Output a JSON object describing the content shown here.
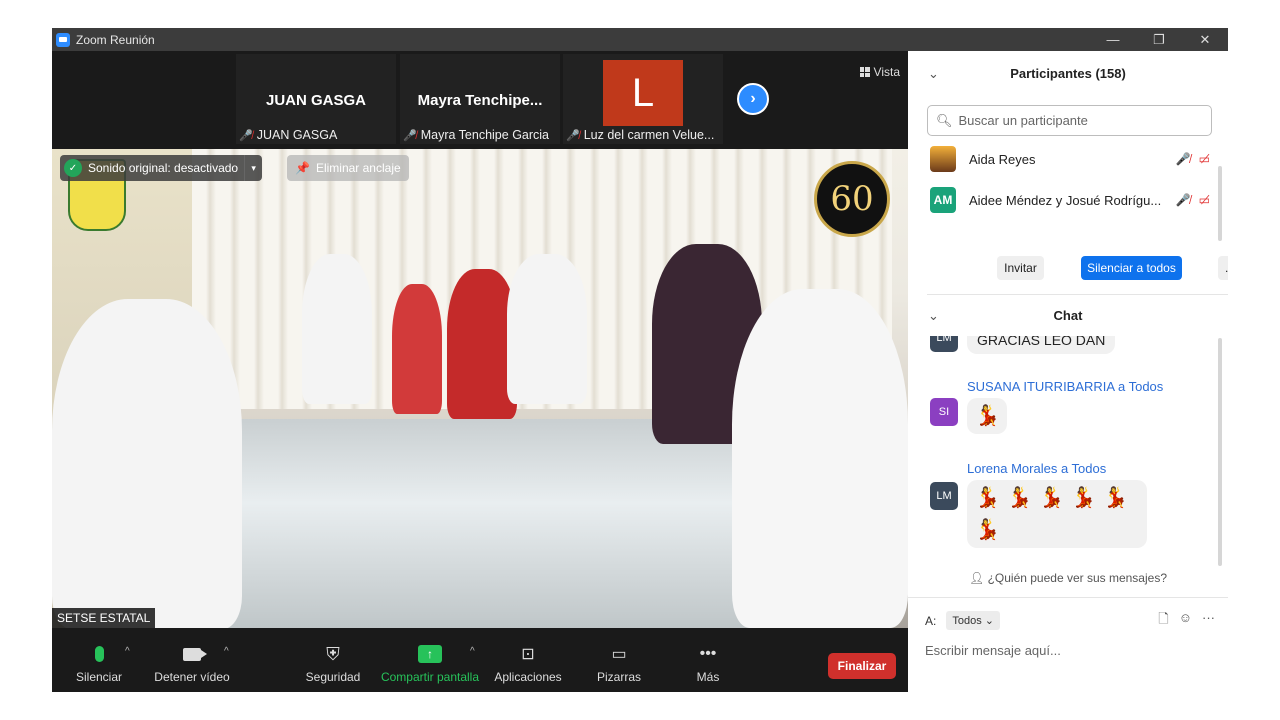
{
  "window": {
    "title": "Zoom Reunión",
    "controls": [
      "—",
      "❐",
      "✕"
    ]
  },
  "strip": {
    "tiles": [
      {
        "name": "JUAN GASGA",
        "label": "JUAN GASGA"
      },
      {
        "name": "Mayra  Tenchipe...",
        "label": "Mayra Tenchipe Garcia"
      },
      {
        "avatar": "L",
        "label": "Luz del carmen Velue..."
      }
    ],
    "view_label": "Vista"
  },
  "main_video": {
    "sound_label": "Sonido original: desactivado",
    "unpin_label": "Eliminar anclaje",
    "badge_text": "60",
    "speaker_name": "SETSE ESTATAL"
  },
  "toolbar": {
    "mute": "Silenciar",
    "stop_video": "Detener vídeo",
    "security": "Seguridad",
    "share": "Compartir pantalla",
    "apps": "Aplicaciones",
    "whiteboards": "Pizarras",
    "more": "Más",
    "end": "Finalizar"
  },
  "participants": {
    "title": "Participantes (158)",
    "search_placeholder": "Buscar un participante",
    "list": [
      {
        "name": "Aida Reyes",
        "initials": ""
      },
      {
        "name": "Aidee Méndez y Josué Rodrígu...",
        "initials": "AM"
      }
    ],
    "invite": "Invitar",
    "mute_all": "Silenciar a todos",
    "more": "..."
  },
  "chat": {
    "title": "Chat",
    "messages": [
      {
        "initials": "LM",
        "text": "GRACIAS LEO DAN"
      },
      {
        "initials": "SI",
        "header": "SUSANA ITURRIBARRIA a Todos",
        "emoji_count": 1
      },
      {
        "initials": "LM",
        "header": "Lorena Morales a Todos",
        "emoji_count": 6
      }
    ],
    "who_can_see": "¿Quién puede ver sus mensajes?",
    "to_label": "A:",
    "to_value": "Todos",
    "compose_placeholder": "Escribir mensaje aquí..."
  },
  "colors": {
    "accent": "#2d8cff",
    "end": "#d0302c",
    "green": "#27c25a",
    "mute_red": "#e03030"
  }
}
